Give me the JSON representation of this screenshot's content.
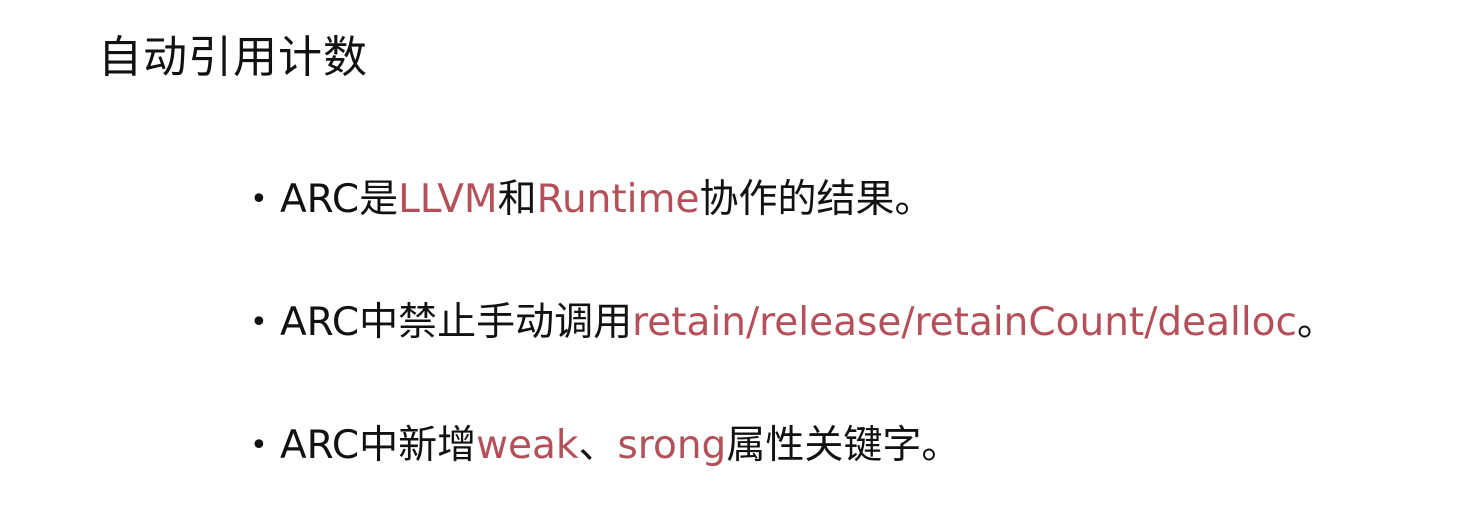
{
  "title": "自动引用计数",
  "bullet_symbol": "•",
  "accent_color": "#b4505a",
  "bullets": [
    {
      "parts": [
        "ARC是",
        "LLVM",
        "和",
        "Runtime",
        "协作的结果。"
      ]
    },
    {
      "parts": [
        "ARC中禁止手动调用",
        "retain/release/retainCount/dealloc",
        "。"
      ]
    },
    {
      "parts": [
        "ARC中新增",
        "weak",
        "、",
        "srong",
        "属性关键字。"
      ]
    }
  ]
}
